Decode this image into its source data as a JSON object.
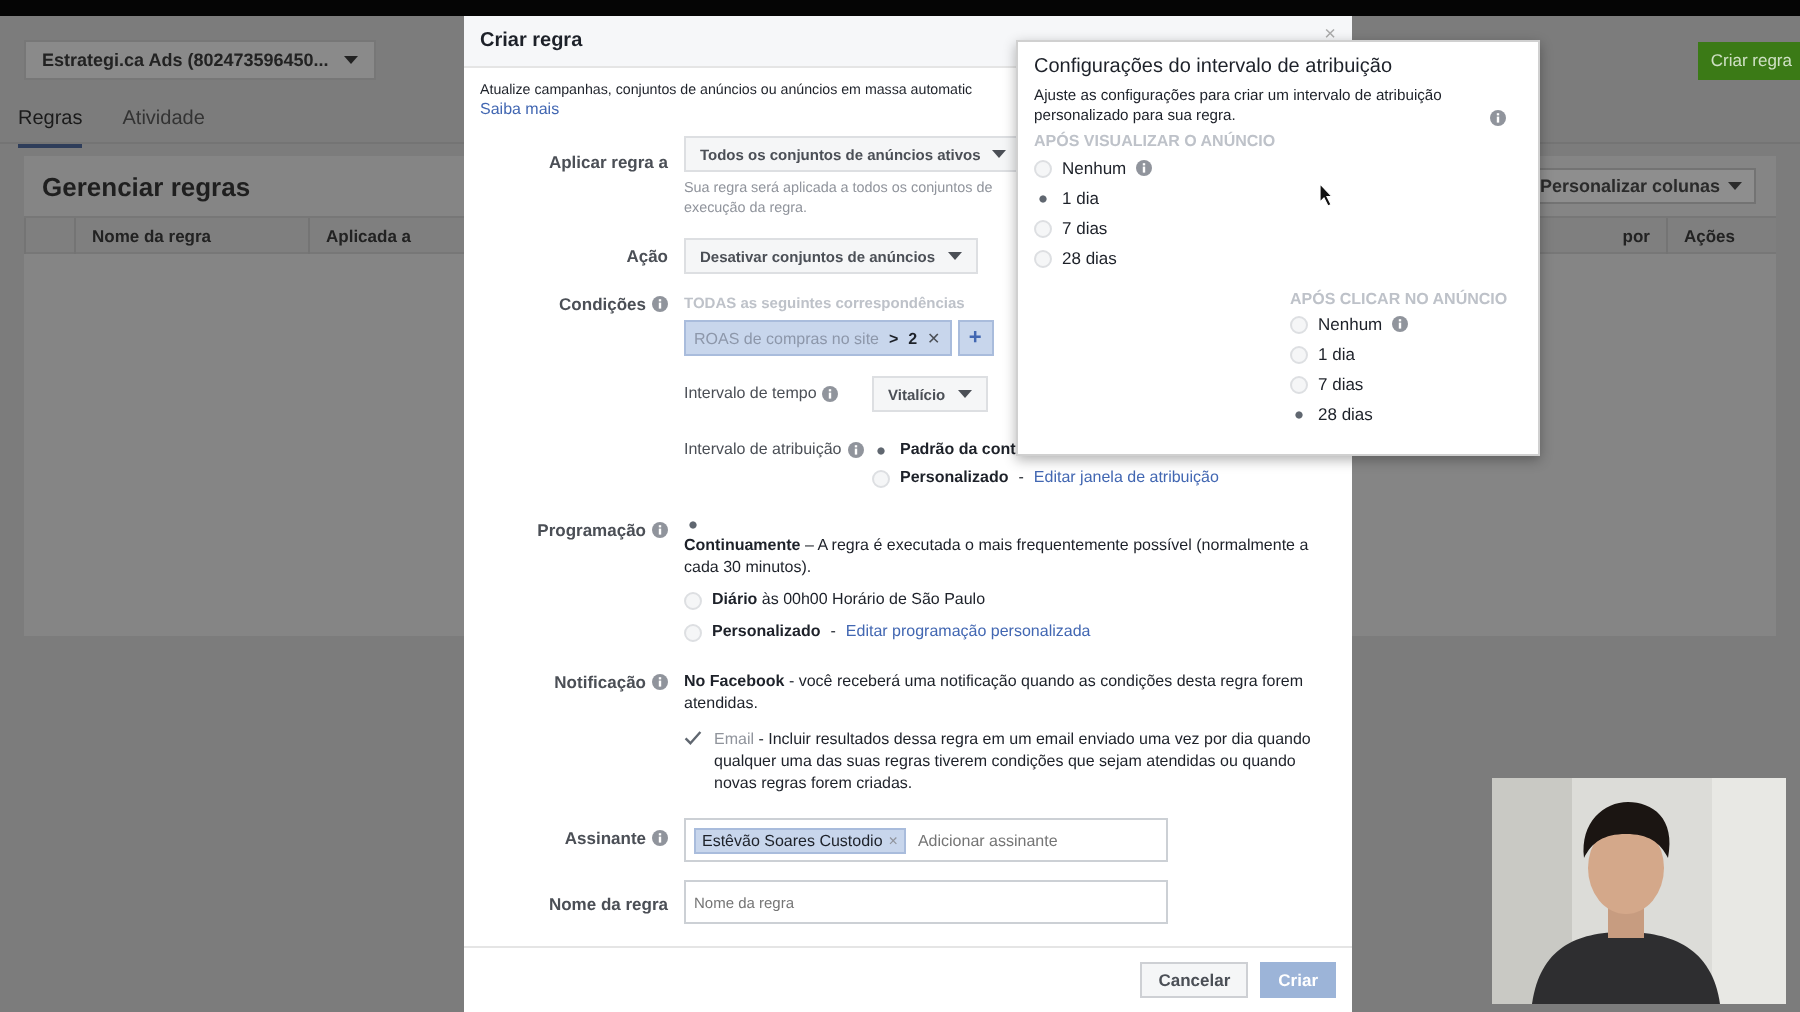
{
  "account_selector": {
    "label": "Estrategi.ca Ads (802473596450..."
  },
  "create_button": "Criar regra",
  "tabs": [
    {
      "label": "Regras",
      "selected": true
    },
    {
      "label": "Atividade",
      "selected": false
    }
  ],
  "panel": {
    "title": "Gerenciar regras",
    "customize_button": "Personalizar colunas",
    "columns": [
      "Nome da regra",
      "Aplicada a",
      "por",
      "Ações"
    ]
  },
  "dialog": {
    "title": "Criar regra",
    "close": "×",
    "separator": "-",
    "intro": "Atualize campanhas, conjuntos de anúncios ou anúncios em massa automatic",
    "learn_more": "Saiba mais",
    "apply_label": "Aplicar regra a",
    "apply_value": "Todos os conjuntos de anúncios ativos",
    "apply_help": "Sua regra será aplicada a todos os conjuntos de\nexecução da regra.",
    "action_label": "Ação",
    "action_value": "Desativar conjuntos de anúncios",
    "conditions_label": "Condições",
    "conditions_hint": "TODAS as seguintes correspondências",
    "condition": {
      "metric": "ROAS de compras no site",
      "operator": ">",
      "value": "2",
      "remove": "✕",
      "add": "+"
    },
    "time_label": "Intervalo de tempo",
    "time_value": "Vitalício",
    "attribution_label": "Intervalo de atribuição",
    "attribution_options": [
      {
        "label": "Padrão da cont",
        "selected": true
      },
      {
        "label": "Personalizado",
        "link": "Editar janela de atribuição",
        "selected": false
      }
    ],
    "schedule_label": "Programação",
    "schedule_options": [
      {
        "title": "Continuamente",
        "text": " – A regra é executada o mais frequentemente possível (normalmente a cada 30 minutos).",
        "selected": true
      },
      {
        "title": "Diário",
        "text": " às 00h00 Horário de São Paulo",
        "selected": false
      },
      {
        "title": "Personalizado",
        "link": "Editar programação personalizada",
        "selected": false
      }
    ],
    "notification_label": "Notificação",
    "notification_title": "No Facebook",
    "notification_text": " - você receberá uma notificação quando as condições desta regra forem atendidas.",
    "email": {
      "checked": true,
      "title": "Email",
      "text": " - Incluir resultados dessa regra em um email enviado uma vez por dia quando qualquer uma das suas regras tiverem condições que sejam atendidas ou quando novas regras forem criadas."
    },
    "subscriber_label": "Assinante",
    "subscriber_tag": "Estêvão Soares Custodio",
    "subscriber_remove": "×",
    "subscriber_placeholder": "Adicionar assinante",
    "name_label": "Nome da regra",
    "name_placeholder": "Nome da regra",
    "buttons": [
      {
        "label": "Cancelar",
        "disabled": false
      },
      {
        "label": "Criar",
        "disabled": true
      }
    ]
  },
  "popover": {
    "title": "Configurações do intervalo de atribuição",
    "text": "Ajuste as configurações para criar um intervalo de atribuição personalizado para sua regra.",
    "view_heading": "APÓS VISUALIZAR O ANÚNCIO",
    "view_options": [
      {
        "label": "Nenhum",
        "info": true,
        "selected": false
      },
      {
        "label": "1 dia",
        "selected": true
      },
      {
        "label": "7 dias",
        "selected": false
      },
      {
        "label": "28 dias",
        "selected": false
      }
    ],
    "click_heading": "APÓS CLICAR NO ANÚNCIO",
    "click_options": [
      {
        "label": "Nenhum",
        "info": true,
        "selected": false
      },
      {
        "label": "1 dia",
        "selected": false
      },
      {
        "label": "7 dias",
        "selected": false
      },
      {
        "label": "28 dias",
        "selected": true
      }
    ]
  }
}
